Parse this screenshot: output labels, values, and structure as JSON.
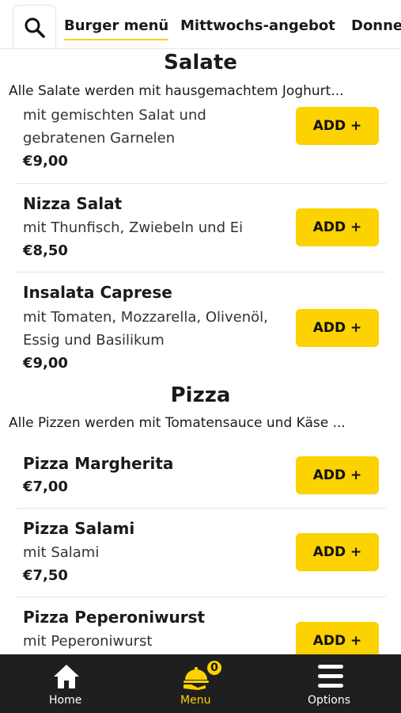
{
  "top_tabs": [
    {
      "label": "Burger menü",
      "active": true
    },
    {
      "label": "Mittwochs-angebot",
      "active": false
    },
    {
      "label": "Donne",
      "active": false
    }
  ],
  "sections": {
    "salate": {
      "title": "Salate",
      "description": "Alle Salate werden mit hausgemachtem Joghurt...",
      "items": [
        {
          "name": "",
          "description": "mit gemischten Salat und gebratenen Garnelen",
          "price": "€9,00",
          "button": "ADD +"
        },
        {
          "name": "Nizza Salat",
          "description": "mit Thunfisch, Zwiebeln und Ei",
          "price": "€8,50",
          "button": "ADD +"
        },
        {
          "name": "Insalata Caprese",
          "description": "mit Tomaten, Mozzarella, Olivenöl, Essig und Basilikum",
          "price": "€9,00",
          "button": "ADD +"
        }
      ]
    },
    "pizza": {
      "title": "Pizza",
      "description": "Alle Pizzen werden mit Tomatensauce und Käse ...",
      "items": [
        {
          "name": "Pizza Margherita",
          "description": "",
          "price": "€7,00",
          "button": "ADD +"
        },
        {
          "name": "Pizza Salami",
          "description": "mit Salami",
          "price": "€7,50",
          "button": "ADD +"
        },
        {
          "name": "Pizza Peperoniwurst",
          "description": "mit Peperoniwurst",
          "price": "",
          "button": "ADD +"
        }
      ]
    }
  },
  "bottom_nav": {
    "home": {
      "label": "Home",
      "icon": "home-icon"
    },
    "menu": {
      "label": "Menu",
      "icon": "food-tray-icon",
      "badge": "0"
    },
    "options": {
      "label": "Options",
      "icon": "hamburger-menu-icon"
    }
  },
  "colors": {
    "accent": "#fcd200",
    "nav_bg": "#1f1f1f"
  }
}
